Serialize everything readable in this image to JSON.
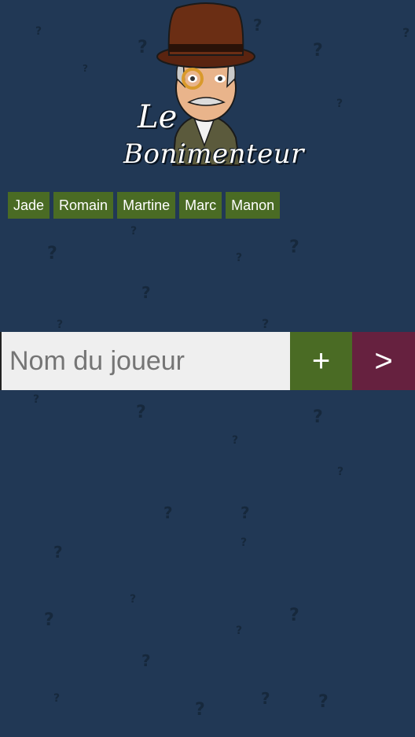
{
  "logo": {
    "line1": "Le",
    "line2": "Bonimenteur"
  },
  "players": [
    "Jade",
    "Romain",
    "Martine",
    "Marc",
    "Manon"
  ],
  "input": {
    "placeholder": "Nom du joueur",
    "value": ""
  },
  "buttons": {
    "add": "+",
    "next": ">"
  },
  "colors": {
    "background": "#213855",
    "tag": "#4a6b24",
    "add": "#4a6b24",
    "next": "#66213f"
  }
}
